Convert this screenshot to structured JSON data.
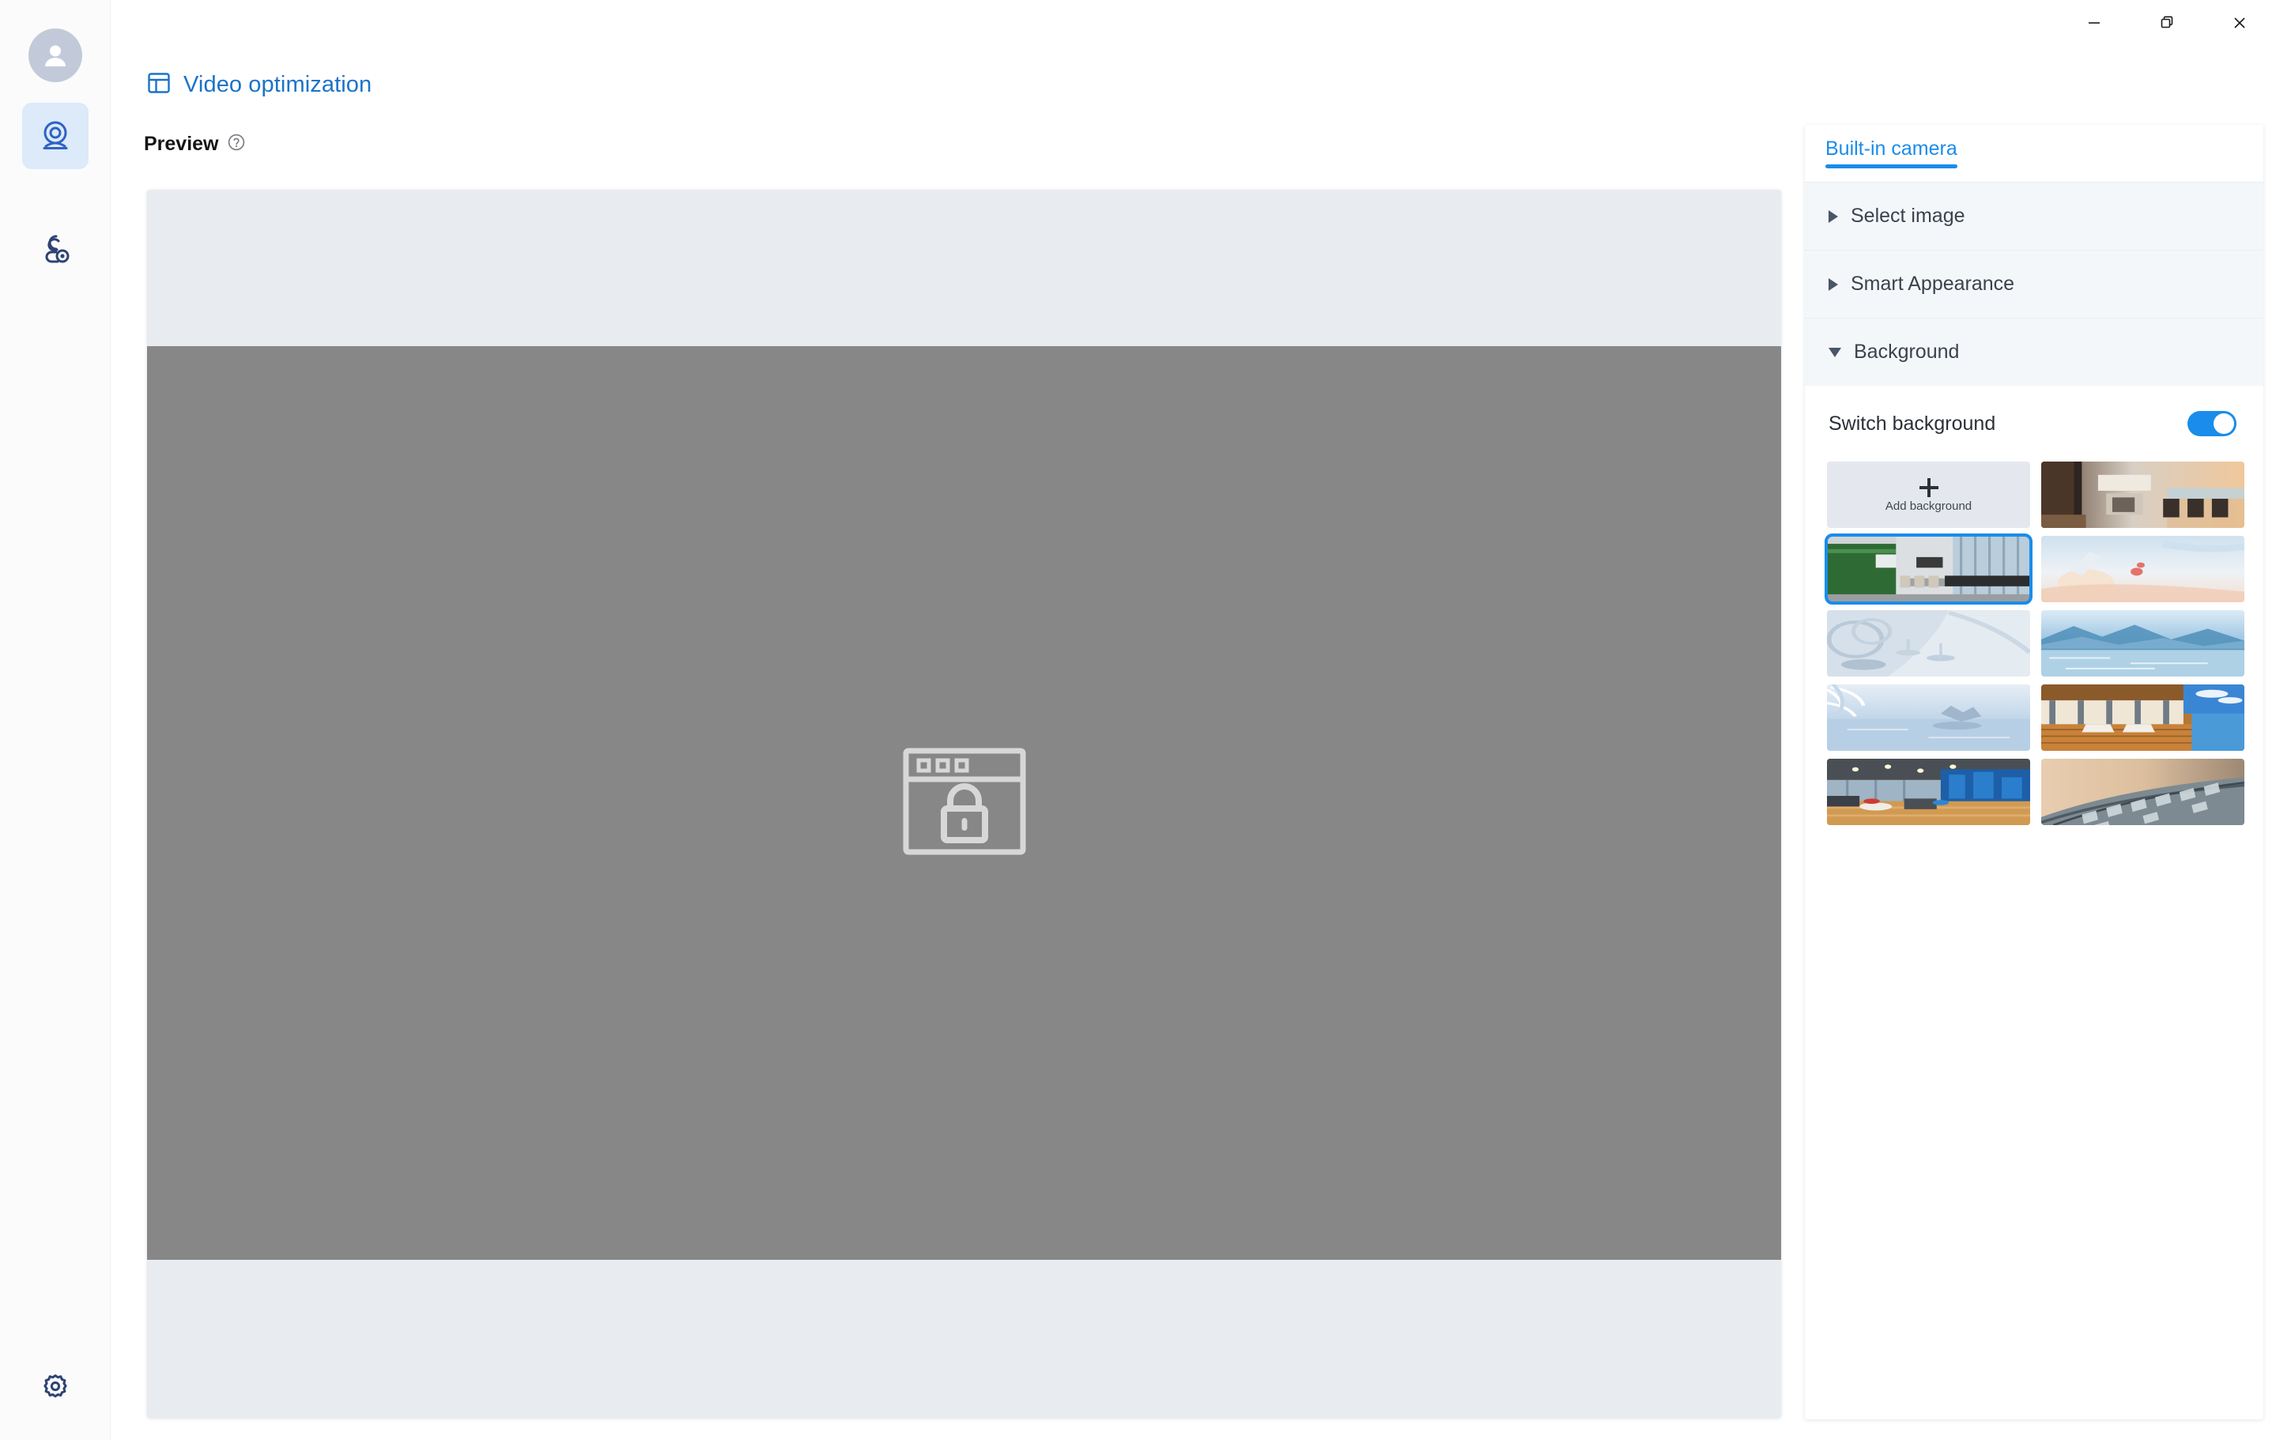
{
  "window": {
    "controls": [
      {
        "name": "minimize",
        "glyph": "minimize-icon"
      },
      {
        "name": "maximize",
        "glyph": "restore-icon"
      },
      {
        "name": "close",
        "glyph": "close-icon"
      }
    ]
  },
  "sidebar": {
    "avatar_name": "user-avatar",
    "items": [
      {
        "name": "camera",
        "icon": "webcam-icon",
        "active": true
      },
      {
        "name": "people",
        "icon": "person-camera-icon",
        "active": false
      }
    ],
    "settings": {
      "icon": "gear-icon",
      "label": "Settings"
    }
  },
  "header": {
    "icon": "layout-panel-icon",
    "title": "Video optimization"
  },
  "preview": {
    "label": "Preview",
    "help_icon": "help-circle-icon",
    "placeholder_icon": "browser-lock-icon",
    "outer_color": "#e8ebef",
    "video_color": "#878787"
  },
  "right_panel": {
    "tabs": [
      {
        "label": "Built-in camera",
        "active": true
      }
    ],
    "sections": [
      {
        "label": "Select image",
        "expanded": false
      },
      {
        "label": "Smart Appearance",
        "expanded": false
      },
      {
        "label": "Background",
        "expanded": true
      }
    ],
    "switch": {
      "label": "Switch background",
      "value": "on",
      "accent": "#1a8ceb"
    },
    "add_background": {
      "label": "Add background",
      "icon": "plus-icon"
    },
    "backgrounds": [
      {
        "id": "bg-kitchen-ocean",
        "name": "Modern kitchen with ocean view",
        "selected": false
      },
      {
        "id": "bg-conference-room",
        "name": "Conference room with city windows",
        "selected": true
      },
      {
        "id": "bg-abstract-warm",
        "name": "Abstract pastel sky with glass objects",
        "selected": false
      },
      {
        "id": "bg-glass-abstract",
        "name": "Frosted glass abstract composition",
        "selected": false
      },
      {
        "id": "bg-blue-lake",
        "name": "Blue mountain lake",
        "selected": false
      },
      {
        "id": "bg-winter-water",
        "name": "Winter ice and calm water",
        "selected": false
      },
      {
        "id": "bg-poolside-deck",
        "name": "Poolside wooden deck with loungers",
        "selected": false
      },
      {
        "id": "bg-open-lounge",
        "name": "Modern open-plan office lounge",
        "selected": false
      },
      {
        "id": "bg-curved-facade",
        "name": "Curved glass building facade",
        "selected": false
      }
    ]
  }
}
